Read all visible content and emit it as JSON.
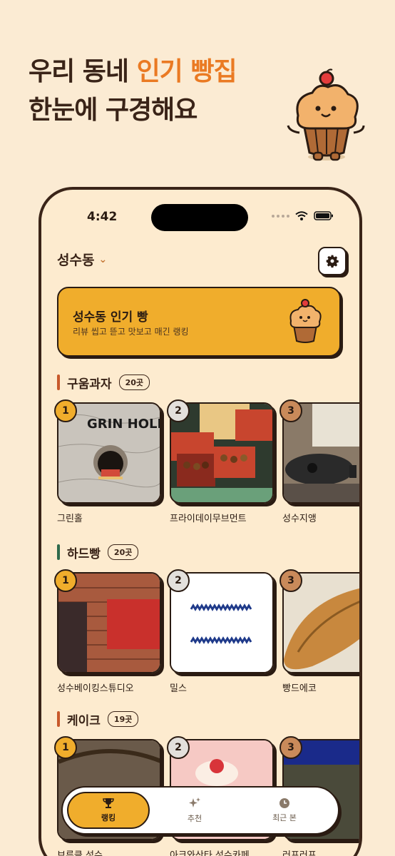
{
  "promo": {
    "line1_prefix": "우리 동네",
    "line1_accent": "인기 빵집",
    "line2": "한눈에 구경해요"
  },
  "status_bar": {
    "time": "4:42"
  },
  "header": {
    "location": "성수동"
  },
  "banner": {
    "title": "성수동 인기 빵",
    "subtitle": "리뷰 씹고 뜯고 맛보고 매긴 랭킹"
  },
  "sections": [
    {
      "title": "구움과자",
      "count": "20곳",
      "accent": "#c8592b",
      "cards": [
        {
          "rank": "1",
          "name": "그린홀",
          "rank_color": "#f0ad2c",
          "sign": "GRIN HOLE"
        },
        {
          "rank": "2",
          "name": "프라이데이무브먼트",
          "rank_color": "#e3e0dc"
        },
        {
          "rank": "3",
          "name": "성수지앵",
          "rank_color": "#c98a5a"
        }
      ]
    },
    {
      "title": "하드빵",
      "count": "20곳",
      "accent": "#2f6a4c",
      "cards": [
        {
          "rank": "1",
          "name": "성수베이킹스튜디오",
          "rank_color": "#f0ad2c"
        },
        {
          "rank": "2",
          "name": "밀스",
          "rank_color": "#e3e0dc"
        },
        {
          "rank": "3",
          "name": "빵드에코",
          "rank_color": "#c98a5a"
        }
      ]
    },
    {
      "title": "케이크",
      "count": "19곳",
      "accent": "#c8592b",
      "cards": [
        {
          "rank": "1",
          "name": "브루클 성수",
          "rank_color": "#f0ad2c"
        },
        {
          "rank": "2",
          "name": "아크와산타 성수카페",
          "rank_color": "#e3e0dc"
        },
        {
          "rank": "3",
          "name": "러프러프",
          "rank_color": "#c98a5a"
        }
      ]
    }
  ],
  "tabs": [
    {
      "label": "랭킹",
      "icon": "trophy-icon",
      "active": true
    },
    {
      "label": "추천",
      "icon": "sparkle-icon",
      "active": false
    },
    {
      "label": "최근 본",
      "icon": "clock-icon",
      "active": false
    }
  ],
  "colors": {
    "background": "#fbebd3",
    "accent_orange": "#ea7a23",
    "banner_yellow": "#f0ad2c",
    "ink": "#2a1b12"
  }
}
